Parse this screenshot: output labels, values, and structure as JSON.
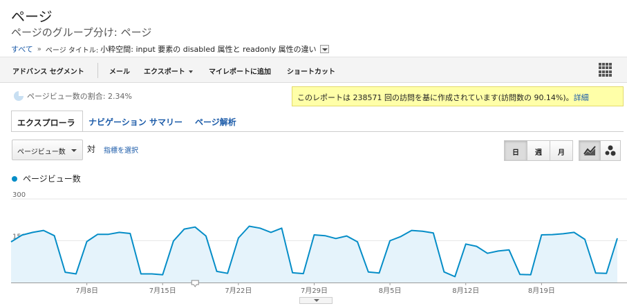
{
  "header": {
    "title": "ページ",
    "subtitle": "ページのグループ分け: ページ"
  },
  "breadcrumb": {
    "root": "すべて",
    "separator": "»",
    "label": "ページ タイトル:",
    "value": "小粋空間: input 要素の disabled 属性と readonly 属性の違い"
  },
  "toolbar": {
    "advanced_segments": "アドバンス セグメント",
    "email": "メール",
    "export": "エクスポート",
    "add_to_dashboard": "マイレポートに追加",
    "shortcut": "ショートカット"
  },
  "summary": {
    "pageview_share": "ページビュー数の割合: 2.34%"
  },
  "notice": {
    "text": "このレポートは 238571 回の訪問を基に作成されています(訪問数の 90.14%)。",
    "link": "詳細"
  },
  "tabs": [
    "エクスプローラ",
    "ナビゲーション サマリー",
    "ページ解析"
  ],
  "controls": {
    "metric": "ページビュー数",
    "vs": "対",
    "choose_metric": "指標を選択",
    "granularity": [
      "日",
      "週",
      "月"
    ]
  },
  "colors": {
    "series": "#058dc7",
    "fill": "#e5f3fb",
    "notice_bg": "#ffffa8",
    "link": "#1a5aa8"
  },
  "chart_data": {
    "type": "area",
    "series": [
      {
        "name": "ページビュー数",
        "values": [
          146,
          170,
          180,
          187,
          168,
          37,
          31,
          147,
          173,
          173,
          180,
          176,
          31,
          31,
          28,
          149,
          192,
          199,
          167,
          40,
          33,
          160,
          202,
          195,
          180,
          195,
          35,
          32,
          171,
          168,
          158,
          167,
          146,
          38,
          34,
          150,
          165,
          187,
          184,
          178,
          38,
          21,
          138,
          130,
          105,
          113,
          117,
          29,
          28,
          171,
          172,
          175,
          180,
          155,
          34,
          33,
          159
        ]
      }
    ],
    "ylim": [
      0,
      300
    ],
    "yticks": [
      150,
      300
    ],
    "xticks": [
      "7月8日",
      "7月15日",
      "7月22日",
      "7月29日",
      "8月5日",
      "8月12日",
      "8月19日"
    ],
    "xtick_indices": [
      7,
      14,
      21,
      28,
      35,
      42,
      49
    ],
    "annotation_index": 17,
    "grid": true
  }
}
